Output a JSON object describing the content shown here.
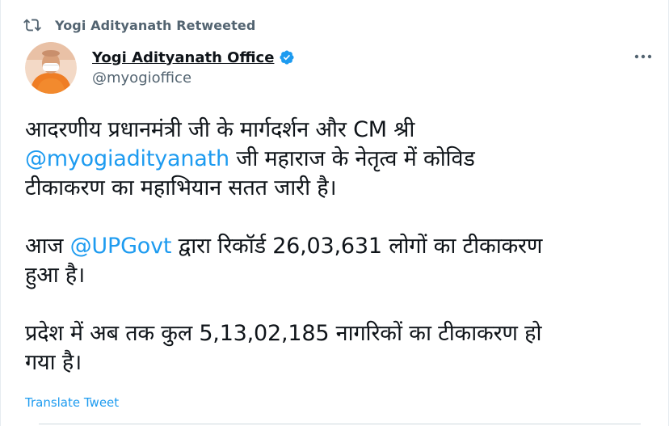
{
  "retweet_header": {
    "label": "Yogi Adityanath Retweeted",
    "icon": "retweet-icon"
  },
  "author": {
    "display_name": "Yogi Adityanath Office",
    "handle": "@myogioffice",
    "verified": true,
    "verified_icon": "verified-badge-icon",
    "avatar_icon": "avatar"
  },
  "more_menu_icon": "more-options-icon",
  "tweet": {
    "paragraph1": {
      "line1": "आदरणीय प्रधानमंत्री जी के मार्गदर्शन और CM श्री",
      "mention": "@myogiadityanath",
      "line2_rest": " जी महाराज के नेतृत्व में कोविड",
      "line3": "टीकाकरण का महाभियान सतत जारी है।"
    },
    "paragraph2": {
      "prefix": "आज ",
      "mention": "@UPGovt",
      "rest": " द्वारा रिकॉर्ड 26,03,631 लोगों का टीकाकरण",
      "line2": "हुआ है।"
    },
    "paragraph3": {
      "line1": "प्रदेश में अब तक कुल 5,13,02,185 नागरिकों का टीकाकरण हो",
      "line2": "गया है।"
    }
  },
  "translate_label": "Translate Tweet",
  "colors": {
    "accent": "#1d9bf0",
    "secondary_text": "#536471",
    "primary_text": "#0f1419",
    "divider": "#cfd9de"
  }
}
